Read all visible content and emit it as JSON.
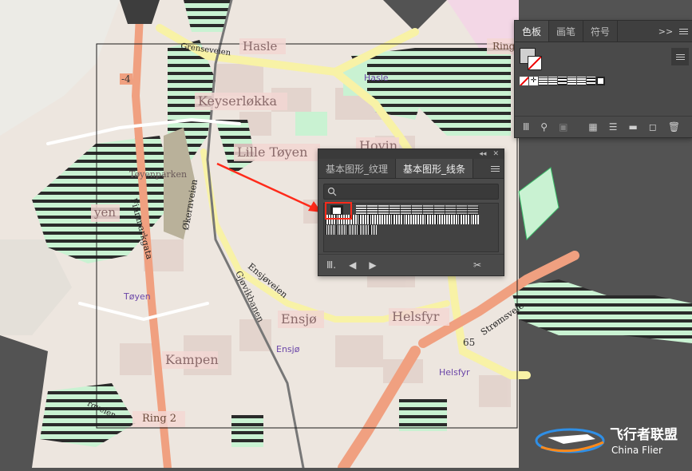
{
  "map": {
    "labels": {
      "hasle": "Hasle",
      "keyserlokka": "Keyserløkka",
      "lille_toyen": "Lille Tøyen",
      "hovin": "Hovin",
      "ensjo": "Ensjø",
      "helsfyr": "Helsfyr",
      "kampen": "Kampen",
      "toyenparken": "Tøyenparken",
      "toyen_partial": "yen",
      "ring2": "Ring 2",
      "ring_top": "Ring",
      "route4": "-4",
      "route65": "65"
    },
    "streets": {
      "grenseveien": "Grenseveien",
      "okernveien": "Økernveien",
      "ensjoveien": "Ensjøveien",
      "gjovikbanen": "Gjøvikbanen",
      "finnmarkgata": "Finnmarkgata",
      "stromsveien": "Strømsveie",
      "ringveien": "rgveien"
    },
    "stations": {
      "hasle": "Hasle",
      "toyen": "Tøyen",
      "ensjo": "Ensjø",
      "helsfyr": "Helsfyr"
    }
  },
  "color_panel": {
    "tabs": [
      "色板",
      "画笔",
      "符号"
    ],
    "active_tab": 0,
    "collapse_glyph": ">>",
    "menu_icon": "hamburger-icon"
  },
  "pattern_panel": {
    "tabs": [
      "基本图形_纹理",
      "基本图形_线条"
    ],
    "active_tab": 1,
    "search_placeholder": "",
    "titlebar_glyphs": [
      "◂◂",
      "✕"
    ]
  },
  "watermark": {
    "cn": "飞行者联盟",
    "en": "China Flier"
  },
  "colors": {
    "panel_bg": "#4a4a4a",
    "map_park": "#c9f2d2",
    "map_residential": "#e8dcd5",
    "road_yellow": "#f8f2a6",
    "road_orange": "#f0a080",
    "highlight_red": "#ff2a1a",
    "label_pink": "#f3d7d3"
  }
}
